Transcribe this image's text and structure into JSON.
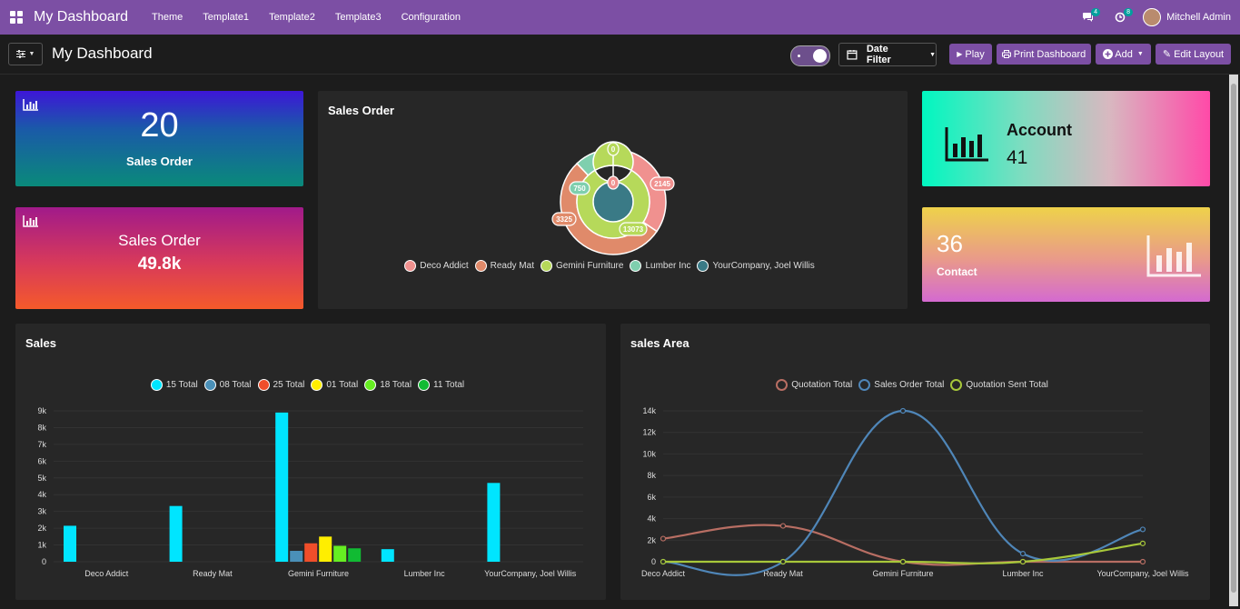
{
  "topbar": {
    "app_title": "My Dashboard",
    "menu": [
      "Theme",
      "Template1",
      "Template2",
      "Template3",
      "Configuration"
    ],
    "messages_badge": "4",
    "activities_badge": "8",
    "user_name": "Mitchell Admin",
    "colors": {
      "bar": "#7c4fa4",
      "badge": "#00a09d"
    }
  },
  "controls": {
    "title": "My Dashboard",
    "date_filter": "Date Filter",
    "play": "Play",
    "print": "Print Dashboard",
    "add": "Add",
    "edit_layout": "Edit Layout"
  },
  "tiles": {
    "sales_order_count": {
      "value": "20",
      "label": "Sales Order"
    },
    "sales_order_amount": {
      "label": "Sales Order",
      "value": "49.8k"
    },
    "account": {
      "label": "Account",
      "value": "41"
    },
    "contact": {
      "value": "36",
      "label": "Contact"
    }
  },
  "sales_order_chart": {
    "title": "Sales Order",
    "legend": [
      "Deco Addict",
      "Ready Mat",
      "Gemini Furniture",
      "Lumber Inc",
      "YourCompany, Joel Willis"
    ],
    "colors": [
      "#f0918f",
      "#e08a6a",
      "#b6d95a",
      "#7fcfae",
      "#3a7a86"
    ],
    "outer_labels": [
      "0",
      "2145",
      "3325",
      "13073",
      "750"
    ],
    "inner_label": "0"
  },
  "sales_chart": {
    "title": "Sales",
    "legend": [
      "15 Total",
      "08 Total",
      "25 Total",
      "01 Total",
      "18 Total",
      "11 Total"
    ],
    "colors": [
      "#00e5ff",
      "#4a90b8",
      "#f04e2a",
      "#ffee00",
      "#66ee22",
      "#11bb33"
    ],
    "y_ticks": [
      "9k",
      "8k",
      "7k",
      "6k",
      "5k",
      "4k",
      "3k",
      "2k",
      "1k",
      "0"
    ]
  },
  "sales_area_chart": {
    "title": "sales Area",
    "legend": [
      "Quotation Total",
      "Sales Order Total",
      "Quotation Sent Total"
    ],
    "colors": [
      "#b86e63",
      "#4f86b8",
      "#a8c83a"
    ],
    "y_ticks": [
      "14k",
      "12k",
      "10k",
      "8k",
      "6k",
      "4k",
      "2k",
      "0"
    ]
  },
  "chart_data": [
    {
      "type": "pie",
      "title": "Sales Order",
      "categories": [
        "Deco Addict",
        "Ready Mat",
        "Gemini Furniture",
        "Lumber Inc",
        "YourCompany, Joel Willis"
      ],
      "series": [
        {
          "values": [
            2145,
            3325,
            0,
            750,
            0
          ]
        },
        {
          "values": [
            0,
            0,
            13073,
            0,
            0
          ]
        }
      ]
    },
    {
      "type": "bar",
      "title": "Sales",
      "categories": [
        "Deco Addict",
        "Ready Mat",
        "Gemini Furniture",
        "Lumber Inc",
        "YourCompany, Joel Willis"
      ],
      "ylim": [
        0,
        9000
      ],
      "series": [
        {
          "name": "15 Total",
          "values": [
            2145,
            3325,
            8900,
            750,
            4700
          ]
        },
        {
          "name": "08 Total",
          "values": [
            0,
            0,
            650,
            0,
            0
          ]
        },
        {
          "name": "25 Total",
          "values": [
            0,
            0,
            1100,
            0,
            0
          ]
        },
        {
          "name": "01 Total",
          "values": [
            0,
            0,
            1500,
            0,
            0
          ]
        },
        {
          "name": "18 Total",
          "values": [
            0,
            0,
            950,
            0,
            0
          ]
        },
        {
          "name": "11 Total",
          "values": [
            0,
            0,
            800,
            0,
            0
          ]
        }
      ]
    },
    {
      "type": "line",
      "title": "sales Area",
      "categories": [
        "Deco Addict",
        "Ready Mat",
        "Gemini Furniture",
        "Lumber Inc",
        "YourCompany, Joel Willis"
      ],
      "ylim": [
        0,
        14000
      ],
      "series": [
        {
          "name": "Quotation Total",
          "values": [
            2145,
            3325,
            0,
            0,
            0
          ]
        },
        {
          "name": "Sales Order Total",
          "values": [
            0,
            0,
            14000,
            750,
            3000
          ]
        },
        {
          "name": "Quotation Sent Total",
          "values": [
            0,
            0,
            0,
            0,
            1700
          ]
        }
      ]
    }
  ]
}
